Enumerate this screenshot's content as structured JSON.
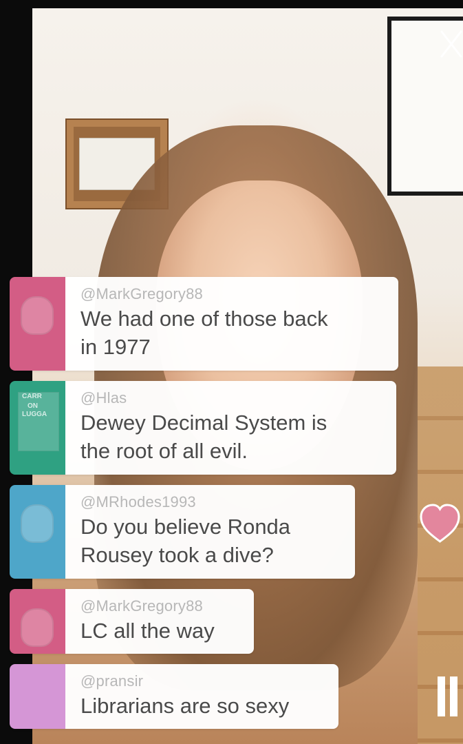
{
  "comments": [
    {
      "username": "@MarkGregory88",
      "message": "We had one of those back\nin 1977",
      "avatar": "avatar-mark1",
      "avatar_color": "#d35d85"
    },
    {
      "username": "@Hlas",
      "message": "Dewey Decimal System is\nthe root of all evil.",
      "avatar": "avatar-hlas",
      "avatar_color": "#2fa182",
      "avatar_texts": [
        "CARR",
        "ON",
        "LUGGA"
      ]
    },
    {
      "username": "@MRhodes1993",
      "message": "Do you believe Ronda\nRousey took a dive?",
      "avatar": "avatar-mr",
      "avatar_color": "#4ea6c9"
    },
    {
      "username": "@MarkGregory88",
      "message": "LC all the way",
      "avatar": "avatar-mark2",
      "avatar_color": "#d35d85"
    },
    {
      "username": "@pransir",
      "message": "Librarians are so sexy",
      "avatar": "avatar-pransir",
      "avatar_color": "#d596d6"
    }
  ],
  "icons": {
    "close": "close-icon",
    "heart": "heart-icon",
    "pause": "pause-icon"
  },
  "colors": {
    "heart": "#e3869d",
    "bubble_bg": "#ffffff",
    "username": "#b7b7b7",
    "message": "#4a4a4a"
  }
}
